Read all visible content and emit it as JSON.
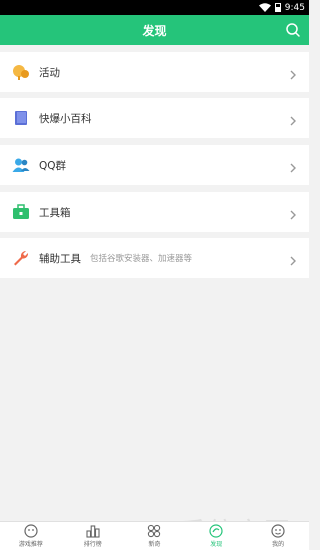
{
  "status_bar": {
    "time": "9:45"
  },
  "header": {
    "title": "发现",
    "search_icon": "search-icon"
  },
  "items": [
    {
      "label": "活动",
      "icon": "activity-icon",
      "color": "#f5b843"
    },
    {
      "label": "快爆小百科",
      "icon": "book-icon",
      "color": "#5b6fd6"
    },
    {
      "label": "QQ群",
      "icon": "group-icon",
      "color": "#3aa9e8"
    },
    {
      "label": "工具箱",
      "icon": "toolbox-icon",
      "color": "#2fbf6e"
    },
    {
      "label": "辅助工具",
      "sub": "包括谷歌安装器、加速器等",
      "icon": "wrench-icon",
      "color": "#ef6a4a"
    }
  ],
  "tabs": [
    {
      "label": "游戏推荐",
      "icon": "game-controller-icon"
    },
    {
      "label": "排行榜",
      "icon": "ranking-icon"
    },
    {
      "label": "新奇",
      "icon": "novelty-icon"
    },
    {
      "label": "发现",
      "icon": "discover-icon",
      "active": true
    },
    {
      "label": "我的",
      "icon": "profile-icon"
    }
  ],
  "watermark": "系统家园",
  "colors": {
    "accent": "#25c47a",
    "background": "#f2f2f2"
  }
}
